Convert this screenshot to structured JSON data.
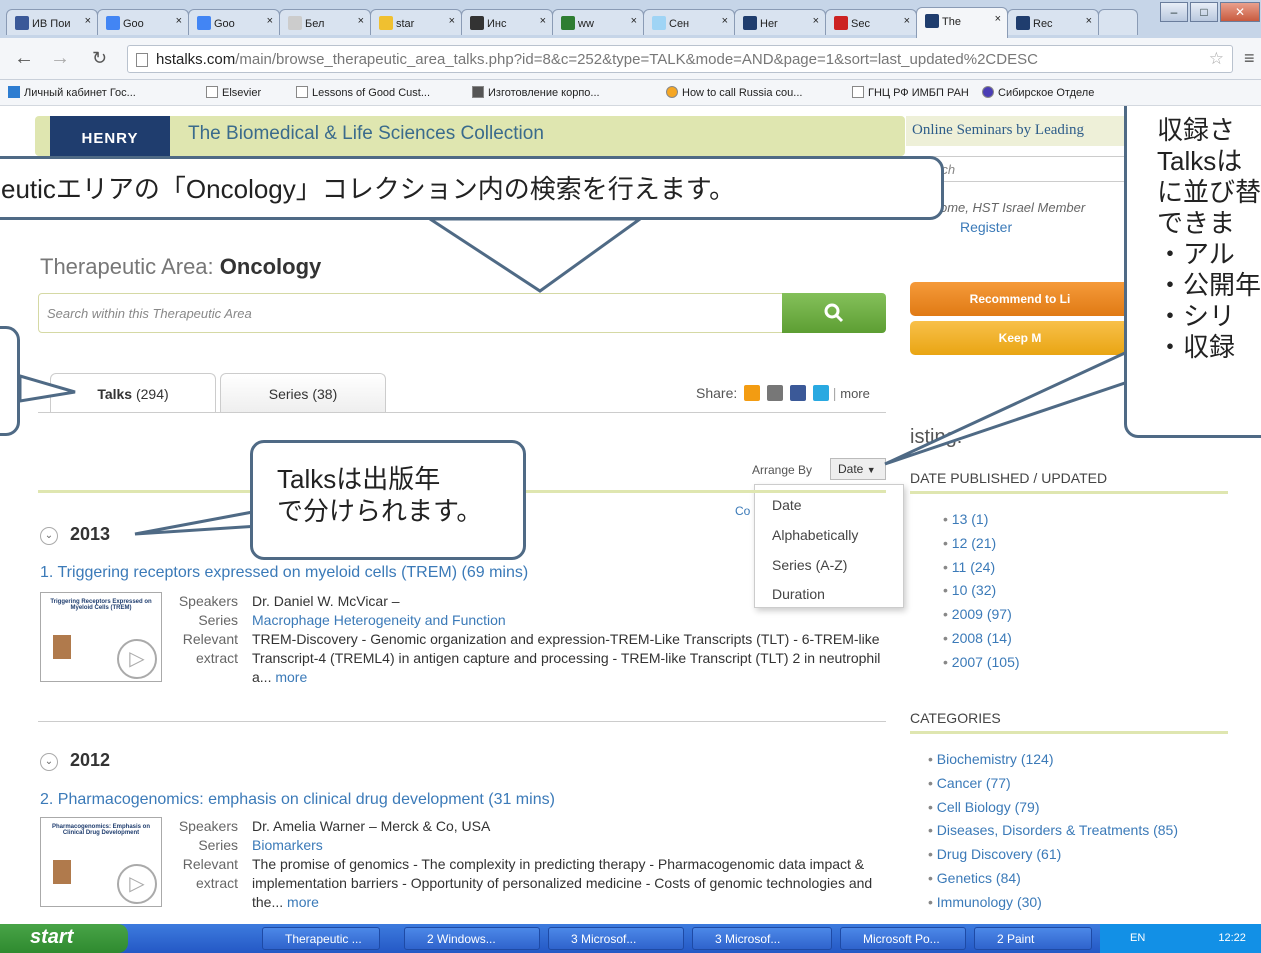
{
  "browser": {
    "tabs": [
      {
        "label": "ИВ Пои",
        "color": "#3b5998",
        "active": false
      },
      {
        "label": "Goo",
        "color": "#4285f4",
        "active": false
      },
      {
        "label": "Goo",
        "color": "#4285f4",
        "active": false
      },
      {
        "label": "Бел",
        "color": "#cccccc",
        "active": false
      },
      {
        "label": "star",
        "color": "#f0c030",
        "active": false
      },
      {
        "label": "Инс",
        "color": "#333333",
        "active": false
      },
      {
        "label": "ww",
        "color": "#2e7d32",
        "active": false
      },
      {
        "label": "Сен",
        "color": "#9fd4f5",
        "active": false
      },
      {
        "label": "Her",
        "color": "#1f3d6e",
        "active": false
      },
      {
        "label": "Sec",
        "color": "#cc2222",
        "active": false
      },
      {
        "label": "The",
        "color": "#1f3d6e",
        "active": true
      },
      {
        "label": "Rec",
        "color": "#1f3d6e",
        "active": false
      }
    ],
    "url_host": "hstalks.com",
    "url_path": "/main/browse_therapeutic_area_talks.php?id=8&c=252&type=TALK&mode=AND&page=1&sort=last_updated%2CDESC",
    "bookmarks": [
      "Личный кабинет Гос...",
      "Elsevier",
      "Lessons of Good Cust...",
      "Изготовление корпо...",
      "How to call Russia cou...",
      "ГНЦ РФ ИМБП РАН",
      "Сибирское Отделе"
    ]
  },
  "site": {
    "logo": "HENRY",
    "collection_title": "The Biomedical & Life Sciences Collection",
    "right_header": "Online Seminars by Leading",
    "right_search_placeholder": "rch",
    "welcome": "ome, HST Israel Member",
    "register": "Register",
    "area_label": "Therapeutic Area:",
    "area_name": "Oncology",
    "search_placeholder": "Search within this Therapeutic Area",
    "recommend_btn": "Recommend to Li",
    "keep_btn": "Keep M",
    "tab_talks_label": "Talks",
    "tab_talks_count": "(294)",
    "tab_series_label": "Series",
    "tab_series_count": "(38)",
    "share_label": "Share:",
    "share_more": "more",
    "arrange_label": "Arrange By",
    "arrange_value": "Date",
    "arrange_options": [
      "Date",
      "Alphabetically",
      "Series (A-Z)",
      "Duration"
    ],
    "col_fragment": "Co",
    "filter_title": "isting:",
    "date_header": "DATE PUBLISHED / UPDATED",
    "dates": [
      "13 (1)",
      "12 (21)",
      "11 (24)",
      "10 (32)",
      "2009 (97)",
      "2008 (14)",
      "2007 (105)"
    ],
    "categories_header": "CATEGORIES",
    "categories": [
      "Biochemistry (124)",
      "Cancer (77)",
      "Cell Biology (79)",
      "Diseases, Disorders & Treatments (85)",
      "Drug Discovery (61)",
      "Genetics (84)",
      "Immunology (30)"
    ]
  },
  "talks": [
    {
      "year": "2013",
      "title": "1. Triggering receptors expressed on myeloid cells (TREM) (69 mins)",
      "thumb_text": "Triggering Receptors Expressed on Myeloid Cells (TREM)",
      "speakers": "Dr. Daniel W. McVicar –",
      "series": "Macrophage Heterogeneity and Function",
      "extract": "TREM-Discovery - Genomic organization and expression-TREM-Like Transcripts (TLT) - 6-TREM-like Transcript-4 (TREML4) in antigen capture and processing - TREM-like Transcript (TLT) 2 in neutrophil a...",
      "more": "more"
    },
    {
      "year": "2012",
      "title": "2. Pharmacogenomics: emphasis on clinical drug development (31 mins)",
      "thumb_text": "Pharmacogenomics: Emphasis on Clinical Drug Development",
      "speakers": "Dr. Amelia Warner – Merck & Co, USA",
      "series": "Biomarkers",
      "extract": "The promise of genomics - The complexity in predicting therapy - Pharmacogenomic data impact & implementation barriers - Opportunity of personalized medicine - Costs of genomic technologies and the...",
      "more": "more"
    }
  ],
  "meta_labels": {
    "speakers": "Speakers",
    "series": "Series",
    "relevant": "Relevant",
    "extract": "extract"
  },
  "callouts": {
    "top": "euticエリアの「Oncology」コレクション内の検索を行えます。",
    "year": "Talksは出版年\nで分けられます。",
    "right": "収録さ\nTalksは\nに並び替\nできま\n・アル\n・公開年\n・シリ\n・収録"
  },
  "taskbar": {
    "start": "start",
    "items": [
      "Therapeutic ...",
      "2 Windows...",
      "3 Microsof...",
      "3 Microsof...",
      "Microsoft Po...",
      "2 Paint"
    ],
    "lang": "EN",
    "time": "12:22"
  }
}
